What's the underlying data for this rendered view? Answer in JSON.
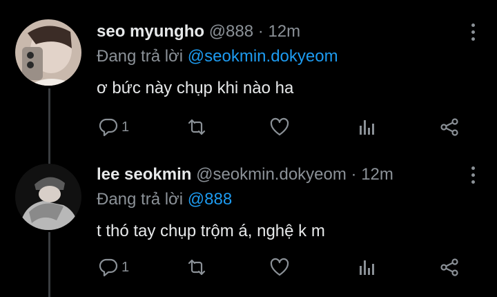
{
  "tweets": [
    {
      "name": "seo myungho",
      "handle": "@888",
      "separator": "·",
      "time": "12m",
      "reply_prefix": "Đang trả lời",
      "reply_to": "@seokmin.dokyeom",
      "text": "ơ bức này chụp khi nào ha",
      "reply_count": "1"
    },
    {
      "name": "lee seokmin",
      "handle": "@seokmin.dokyeom",
      "separator": "·",
      "time": "12m",
      "reply_prefix": "Đang trả lời",
      "reply_to": "@888",
      "text": "t thó tay chụp trộm á, nghệ k m",
      "reply_count": "1"
    }
  ],
  "colors": {
    "accent": "#1d9bf0",
    "muted": "#8b9197",
    "text": "#e7e9ea",
    "background": "#000000"
  },
  "icons": [
    "reply-icon",
    "retweet-icon",
    "like-icon",
    "views-icon",
    "share-icon",
    "more-options-icon"
  ]
}
